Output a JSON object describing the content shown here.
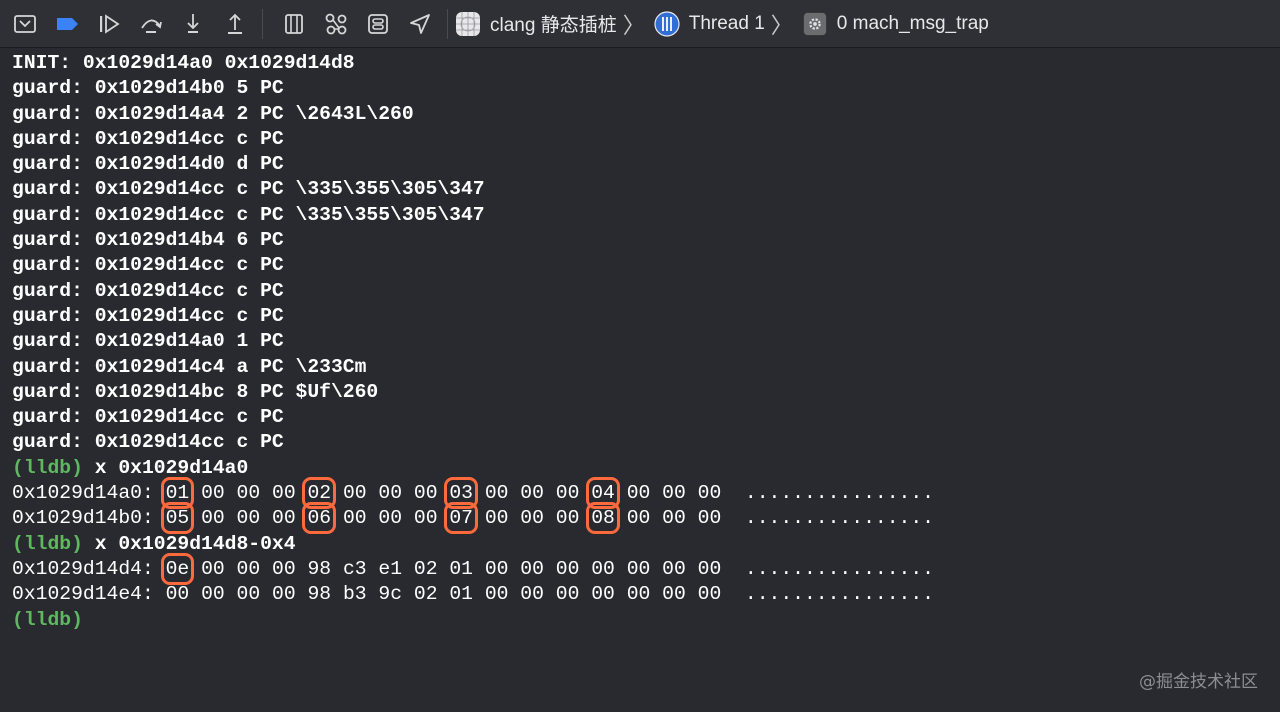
{
  "toolbar": {
    "breadcrumbs": [
      {
        "label": "clang 静态插桩"
      },
      {
        "label": "Thread 1"
      },
      {
        "label": "0 mach_msg_trap"
      }
    ]
  },
  "console": {
    "log_lines": [
      "INIT: 0x1029d14a0 0x1029d14d8",
      "guard: 0x1029d14b0 5 PC",
      "guard: 0x1029d14a4 2 PC \\2643L\\260",
      "guard: 0x1029d14cc c PC",
      "guard: 0x1029d14d0 d PC",
      "guard: 0x1029d14cc c PC \\335\\355\\305\\347",
      "guard: 0x1029d14cc c PC \\335\\355\\305\\347",
      "guard: 0x1029d14b4 6 PC",
      "guard: 0x1029d14cc c PC",
      "guard: 0x1029d14cc c PC",
      "guard: 0x1029d14cc c PC",
      "guard: 0x1029d14a0 1 PC",
      "guard: 0x1029d14c4 a PC \\233Cm",
      "guard: 0x1029d14bc 8 PC $Uf\\260",
      "guard: 0x1029d14cc c PC",
      "guard: 0x1029d14cc c PC"
    ],
    "prompt": "(lldb)",
    "cmd1": "x 0x1029d14a0",
    "mem1": [
      {
        "addr": "0x1029d14a0:",
        "bytes": [
          "01",
          "00",
          "00",
          "00",
          "02",
          "00",
          "00",
          "00",
          "03",
          "00",
          "00",
          "00",
          "04",
          "00",
          "00",
          "00"
        ],
        "ascii": "................"
      },
      {
        "addr": "0x1029d14b0:",
        "bytes": [
          "05",
          "00",
          "00",
          "00",
          "06",
          "00",
          "00",
          "00",
          "07",
          "00",
          "00",
          "00",
          "08",
          "00",
          "00",
          "00"
        ],
        "ascii": "................"
      }
    ],
    "cmd2": "x 0x1029d14d8-0x4",
    "mem2": [
      {
        "addr": "0x1029d14d4:",
        "bytes": [
          "0e",
          "00",
          "00",
          "00",
          "98",
          "c3",
          "e1",
          "02",
          "01",
          "00",
          "00",
          "00",
          "00",
          "00",
          "00",
          "00"
        ],
        "ascii": "................"
      },
      {
        "addr": "0x1029d14e4:",
        "bytes": [
          "00",
          "00",
          "00",
          "00",
          "98",
          "b3",
          "9c",
          "02",
          "01",
          "00",
          "00",
          "00",
          "00",
          "00",
          "00",
          "00"
        ],
        "ascii": "................"
      }
    ]
  },
  "watermark": "@掘金技术社区",
  "colors": {
    "highlight": "#ff6a3d",
    "prompt": "#5fb85f",
    "breakpoint": "#3b82f6"
  }
}
